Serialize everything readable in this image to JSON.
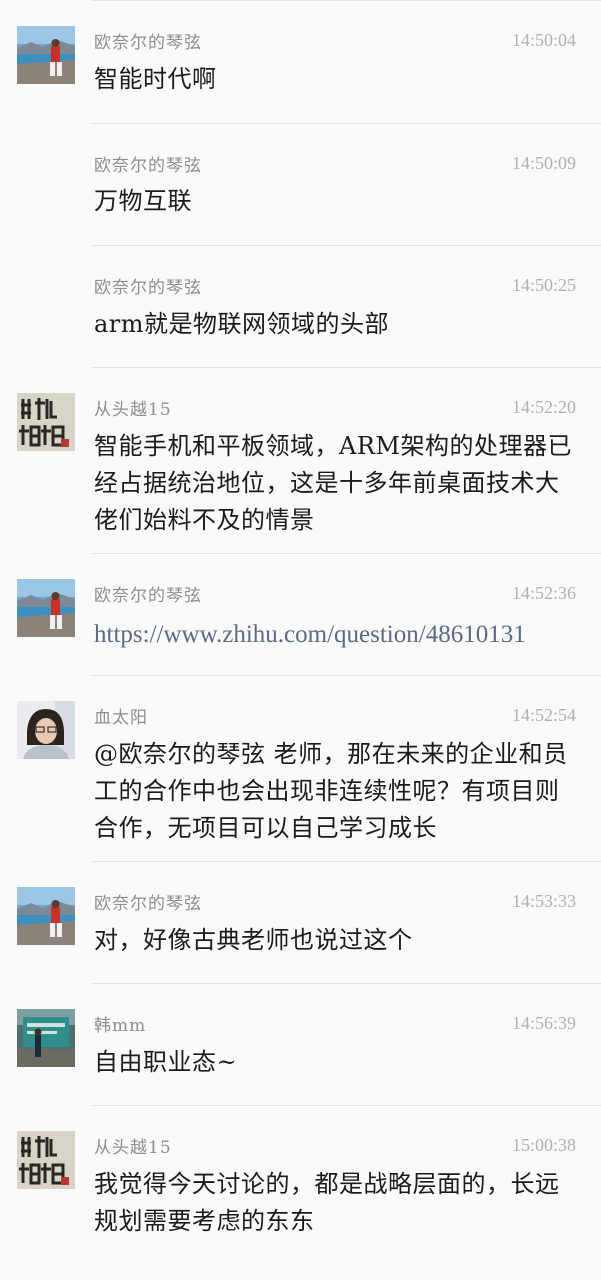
{
  "messages": [
    {
      "sender": "欧奈尔的琴弦",
      "time": "14:50:04",
      "text": "智能时代啊",
      "avatar": "landscape"
    },
    {
      "sender": "欧奈尔的琴弦",
      "time": "14:50:09",
      "text": "万物互联"
    },
    {
      "sender": "欧奈尔的琴弦",
      "time": "14:50:25",
      "text": "arm就是物联网领域的头部"
    },
    {
      "sender": "从头越15",
      "time": "14:52:20",
      "text": "智能手机和平板领域，ARM架构的处理器已经占据统治地位，这是十多年前桌面技术大佬们始料不及的情景",
      "avatar": "calligraphy"
    },
    {
      "sender": "欧奈尔的琴弦",
      "time": "14:52:36",
      "text": "https://www.zhihu.com/question/48610131",
      "avatar": "landscape",
      "link": true
    },
    {
      "sender": "血太阳",
      "time": "14:52:54",
      "text": "@欧奈尔的琴弦 老师，那在未来的企业和员工的合作中也会出现非连续性呢？有项目则合作，无项目可以自己学习成长",
      "avatar": "portrait"
    },
    {
      "sender": "欧奈尔的琴弦",
      "time": "14:53:33",
      "text": "对，好像古典老师也说过这个",
      "avatar": "landscape"
    },
    {
      "sender": "韩mm",
      "time": "14:56:39",
      "text": "自由职业态~",
      "avatar": "stage"
    },
    {
      "sender": "从头越15",
      "time": "15:00:38",
      "text": "我觉得今天讨论的，都是战略层面的，长远规划需要考虑的东东",
      "avatar": "calligraphy"
    }
  ]
}
